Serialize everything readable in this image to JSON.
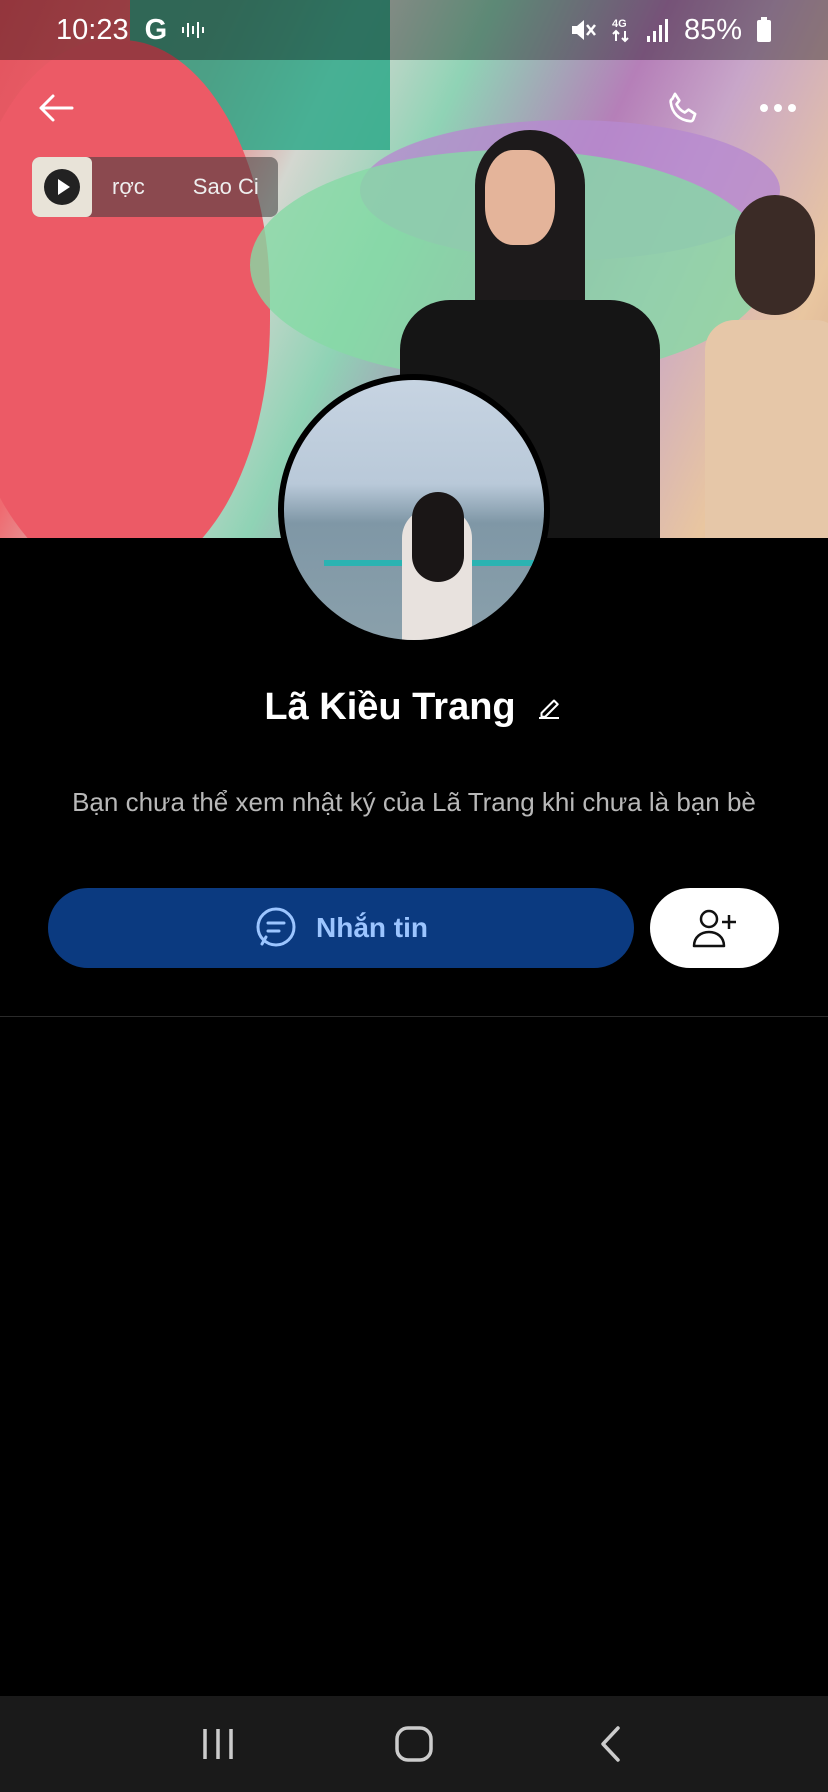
{
  "status_bar": {
    "time": "10:23",
    "google_indicator": "G",
    "battery": "85%",
    "network": "4G"
  },
  "header": {
    "back_icon": "arrow-left-icon",
    "call_icon": "phone-icon",
    "more_icon": "more-horizontal-icon"
  },
  "music_chip": {
    "text_left": "rợc",
    "text_right": "Sao Ci"
  },
  "profile": {
    "name": "Lã Kiều Trang",
    "notice": "Bạn chưa thể xem nhật ký của Lã Trang khi chưa là bạn bè"
  },
  "actions": {
    "message_label": "Nhắn tin",
    "accent_color": "#0b3a80",
    "label_color": "#9cc5ff"
  },
  "system_nav": {
    "recents_icon": "recents-icon",
    "home_icon": "home-icon",
    "back_icon": "nav-back-icon"
  }
}
